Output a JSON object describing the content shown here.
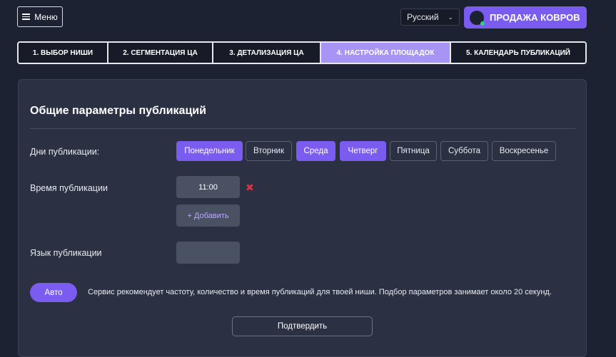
{
  "header": {
    "menu_label": "Меню",
    "language": "Русский",
    "brand_label": "ПРОДАЖА КОВРОВ"
  },
  "steps": [
    {
      "label": "1. ВЫБОР НИШИ",
      "active": false
    },
    {
      "label": "2. СЕГМЕНТАЦИЯ ЦА",
      "active": false
    },
    {
      "label": "3. ДЕТАЛИЗАЦИЯ ЦА",
      "active": false
    },
    {
      "label": "4. НАСТРОЙКА ПЛОЩАДОК",
      "active": true
    },
    {
      "label": "5. КАЛЕНДАРЬ ПУБЛИКАЦИЙ",
      "active": false
    }
  ],
  "card": {
    "title": "Общие параметры публикаций",
    "days_label": "Дни публикации:",
    "days": [
      {
        "label": "Понедельник",
        "selected": true
      },
      {
        "label": "Вторник",
        "selected": false
      },
      {
        "label": "Среда",
        "selected": true
      },
      {
        "label": "Четверг",
        "selected": true
      },
      {
        "label": "Пятница",
        "selected": false
      },
      {
        "label": "Суббота",
        "selected": false
      },
      {
        "label": "Воскресенье",
        "selected": false
      }
    ],
    "time_label": "Время публикации",
    "time_value": "11:00",
    "remove_symbol": "✖",
    "add_label": "+ Добавить",
    "lang_label": "Язык публикации",
    "lang_value": "",
    "auto_label": "Авто",
    "note": "Сервис рекомендует частоту, количество и время публикаций для твоей ниши. Подбор параметров занимает около 20 секунд.",
    "confirm_label": "Подтвердить"
  },
  "colors": {
    "background": "#1c2231",
    "card": "#2b3142",
    "accent": "#7b5cf0",
    "active_step": "#a894f5",
    "danger": "#e0313f"
  }
}
